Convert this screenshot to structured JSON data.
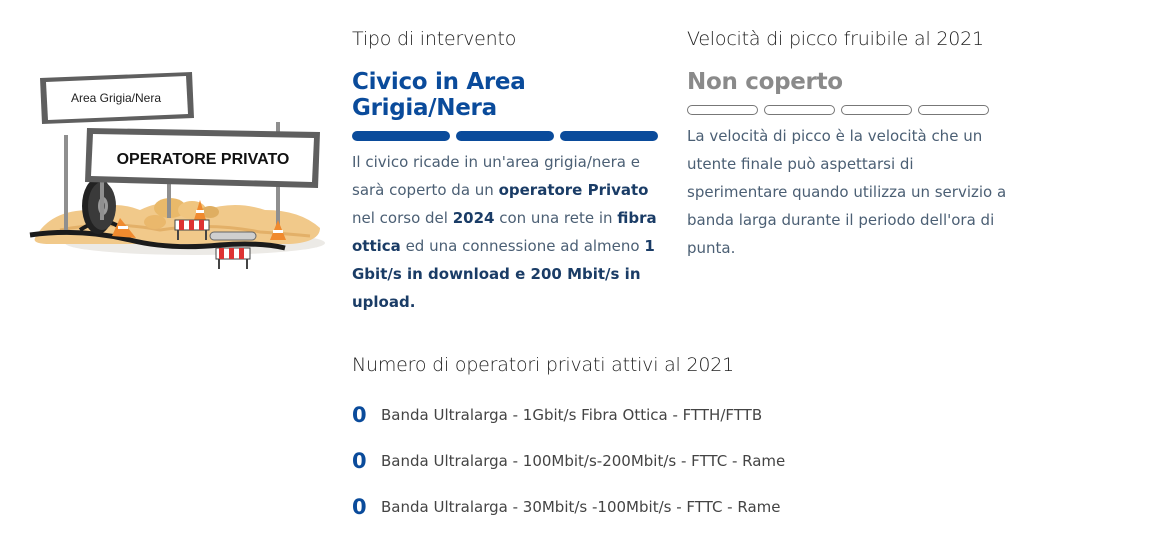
{
  "illustration": {
    "sign_small": "Area Grigia/Nera",
    "sign_large": "OPERATORE PRIVATO"
  },
  "tipo": {
    "title": "Tipo di intervento",
    "value": "Civico in Area Grigia/Nera",
    "bars_filled": 3,
    "bars_total": 3,
    "description": [
      {
        "t": "Il civico ricade in un'area grigia/nera e sarà coperto da un ",
        "b": false
      },
      {
        "t": "operatore Privato",
        "b": true
      },
      {
        "t": " nel corso del ",
        "b": false
      },
      {
        "t": "2024",
        "b": true
      },
      {
        "t": " con una rete in ",
        "b": false
      },
      {
        "t": "fibra ottica",
        "b": true
      },
      {
        "t": " ed una connessione ad almeno ",
        "b": false
      },
      {
        "t": "1 Gbit/s in download e 200 Mbit/s in upload.",
        "b": true
      }
    ]
  },
  "velocita": {
    "title": "Velocità di picco fruibile al 2021",
    "value": "Non coperto",
    "bars_filled": 0,
    "bars_total": 4,
    "description": "La velocità di picco è la velocità che un utente finale può aspettarsi di sperimentare quando utilizza un servizio a banda larga durante il periodo dell'ora di punta."
  },
  "operatori": {
    "title": "Numero di operatori privati attivi al 2021",
    "rows": [
      {
        "count": "0",
        "label": "Banda Ultralarga - 1Gbit/s Fibra Ottica - FTTH/FTTB"
      },
      {
        "count": "0",
        "label": "Banda Ultralarga - 100Mbit/s-200Mbit/s - FTTC - Rame"
      },
      {
        "count": "0",
        "label": "Banda Ultralarga - 30Mbit/s -100Mbit/s - FTTC - Rame"
      }
    ]
  },
  "colors": {
    "accent": "#0a4b9b",
    "muted": "#8a8a8a",
    "text": "#4b5f74"
  }
}
